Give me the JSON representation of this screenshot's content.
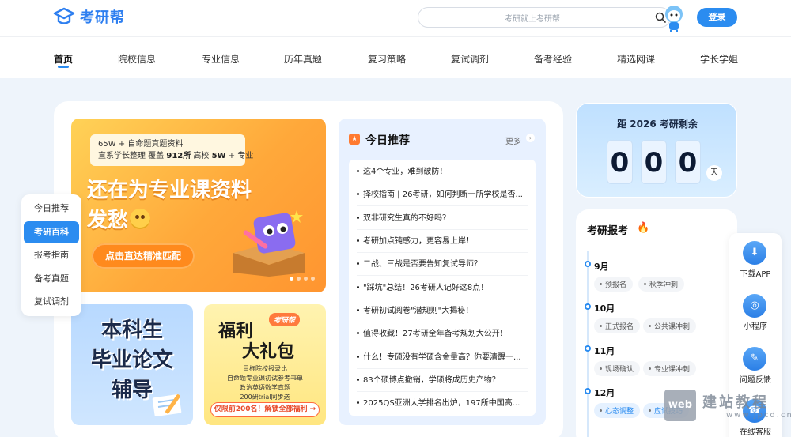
{
  "header": {
    "logo_text": "考研帮",
    "search_placeholder": "考研就上考研帮",
    "login_label": "登录"
  },
  "nav": {
    "items": [
      "首页",
      "院校信息",
      "专业信息",
      "历年真题",
      "复习策略",
      "复试调剂",
      "备考经验",
      "精选网课",
      "学长学姐"
    ],
    "active": "首页"
  },
  "banner": {
    "tag_line1": "65W + 自命题真题资料",
    "tag_line2_a": "直系学长整理 覆盖 ",
    "tag_line2_b": "912所",
    "tag_line2_c": " 高校 ",
    "tag_line2_d": "5W",
    "tag_line2_e": " + 专业",
    "headline1": "还在为专业课资料",
    "headline2": "发愁",
    "cta": "点击直达精准匹配"
  },
  "promo_cards": {
    "thesis_lines": [
      "本科生",
      "毕业论文",
      "辅导"
    ],
    "gift_badge": "考研帮",
    "gift_title1": "福利",
    "gift_title2": "大礼包",
    "gift_lines": [
      "目标院校报录比",
      "自命题专业课初试参考书单",
      "政治英语数学真题",
      "200研trial同步送"
    ],
    "gift_cta": "仅限前200名！解锁全部福利 →"
  },
  "today": {
    "title": "今日推荐",
    "more": "更多",
    "items": [
      "这4个专业，难到破防！",
      "择校指南 | 26考研，如何判断一所学校是否...",
      "双非研究生真的不好吗？",
      "考研加点钝感力，更容易上岸！",
      "二战、三战是否要告知复试导师？",
      "\"踩坑\"总结！26考研人记好这8点！",
      "考研初试阅卷\"潜规则\"大揭秘！",
      "值得收藏！27考研全年备考规划大公开！",
      "什么！专硕没有学硕含金量高？你要清醒一...",
      "83个硕博点撤销，学硕将成历史产物？",
      "2025QS亚洲大学排名出炉，197所中国高..."
    ]
  },
  "side_menu": {
    "items": [
      "今日推荐",
      "考研百科",
      "报考指南",
      "备考真题",
      "复试调剂"
    ],
    "active": "考研百科"
  },
  "countdown": {
    "title": "距 2026 考研剩余",
    "digits": [
      "0",
      "0",
      "0"
    ],
    "unit": "天"
  },
  "schedule": {
    "title": "考研报考",
    "months": [
      {
        "month": "9月",
        "tags": [
          "预报名",
          "秋季冲刺"
        ]
      },
      {
        "month": "10月",
        "tags": [
          "正式报名",
          "公共课冲刺"
        ]
      },
      {
        "month": "11月",
        "tags": [
          "现场确认",
          "专业课冲刺"
        ]
      },
      {
        "month": "12月",
        "tags": [
          "心态调整",
          "应试技巧"
        ]
      }
    ]
  },
  "right_bar": {
    "items": [
      "下载APP",
      "小程序",
      "问题反馈",
      "在线客服"
    ]
  },
  "watermark": {
    "box": "web",
    "text": "建站教程",
    "url": "www.jpcd.cn"
  }
}
